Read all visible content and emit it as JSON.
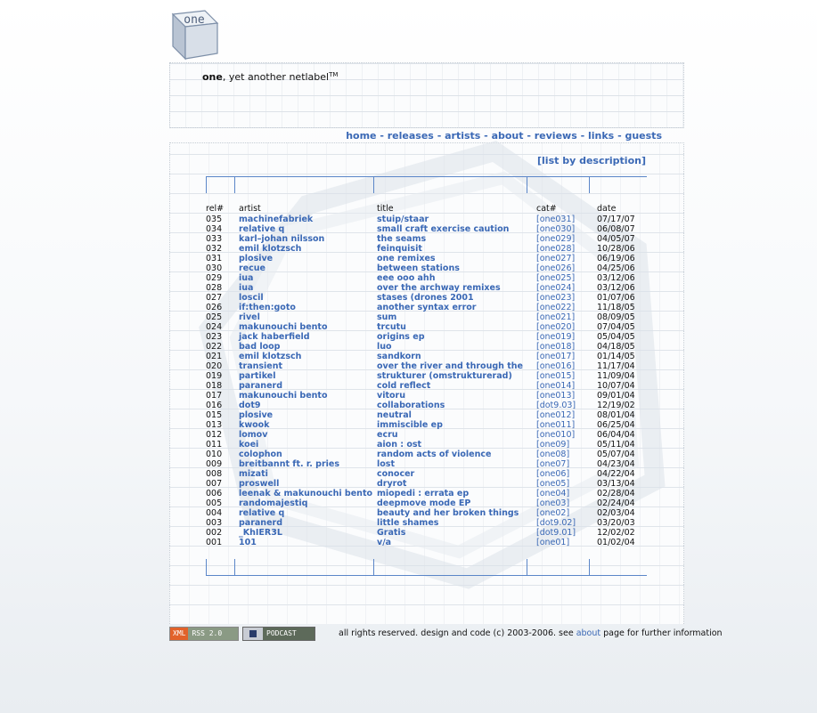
{
  "logo": {
    "text": "one"
  },
  "header": {
    "tagline_bold": "one",
    "tagline_rest": ", yet another netlabel",
    "tagline_tm": "TM"
  },
  "nav": {
    "items": [
      "home",
      "releases",
      "artists",
      "about",
      "reviews",
      "links",
      "guests"
    ],
    "separator": " - "
  },
  "list_by_link": "[list by description]",
  "table": {
    "headers": {
      "rel": "rel#",
      "artist": "artist",
      "title": "title",
      "cat": "cat#",
      "date": "date"
    },
    "rows": [
      {
        "rel": "035",
        "artist": "machinefabriek",
        "title": "stuip/staar",
        "cat": "[one031]",
        "date": "07/17/07"
      },
      {
        "rel": "034",
        "artist": "relative q",
        "title": "small craft exercise caution",
        "cat": "[one030]",
        "date": "06/08/07"
      },
      {
        "rel": "033",
        "artist": "karl–johan nilsson",
        "title": "the seams",
        "cat": "[one029]",
        "date": "04/05/07"
      },
      {
        "rel": "032",
        "artist": "emil klotzsch",
        "title": "feinquisit",
        "cat": "[one028]",
        "date": "10/28/06"
      },
      {
        "rel": "031",
        "artist": "plosive",
        "title": "one remixes",
        "cat": "[one027]",
        "date": "06/19/06"
      },
      {
        "rel": "030",
        "artist": "recue",
        "title": "between stations",
        "cat": "[one026]",
        "date": "04/25/06"
      },
      {
        "rel": "029",
        "artist": "iua",
        "title": "eee ooo ahh",
        "cat": "[one025]",
        "date": "03/12/06"
      },
      {
        "rel": "028",
        "artist": "iua",
        "title": "over the archway remixes",
        "cat": "[one024]",
        "date": "03/12/06"
      },
      {
        "rel": "027",
        "artist": "loscil",
        "title": "stases (drones 2001",
        "cat": "[one023]",
        "date": "01/07/06"
      },
      {
        "rel": "026",
        "artist": "if:then:goto",
        "title": "another syntax error",
        "cat": "[one022]",
        "date": "11/18/05"
      },
      {
        "rel": "025",
        "artist": "rivel",
        "title": "sum",
        "cat": "[one021]",
        "date": "08/09/05"
      },
      {
        "rel": "024",
        "artist": "makunouchi bento",
        "title": "trcutu",
        "cat": "[one020]",
        "date": "07/04/05"
      },
      {
        "rel": "023",
        "artist": "jack haberfield",
        "title": "origins ep",
        "cat": "[one019]",
        "date": "05/04/05"
      },
      {
        "rel": "022",
        "artist": "bad loop",
        "title": "luo",
        "cat": "[one018]",
        "date": "04/18/05"
      },
      {
        "rel": "021",
        "artist": "emil klotzsch",
        "title": "sandkorn",
        "cat": "[one017]",
        "date": "01/14/05"
      },
      {
        "rel": "020",
        "artist": "transient",
        "title": "over the river and through the",
        "cat": "[one016]",
        "date": "11/17/04"
      },
      {
        "rel": "019",
        "artist": "partikel",
        "title": "strukturer (omstrukturerad)",
        "cat": "[one015]",
        "date": "11/09/04"
      },
      {
        "rel": "018",
        "artist": "paranerd",
        "title": "cold reflect",
        "cat": "[one014]",
        "date": "10/07/04"
      },
      {
        "rel": "017",
        "artist": "makunouchi bento",
        "title": "vitoru",
        "cat": "[one013]",
        "date": "09/01/04"
      },
      {
        "rel": "016",
        "artist": "dot9",
        "title": "collaborations",
        "cat": "[dot9.03]",
        "date": "12/19/02"
      },
      {
        "rel": "015",
        "artist": "plosive",
        "title": "neutral",
        "cat": "[one012]",
        "date": "08/01/04"
      },
      {
        "rel": "013",
        "artist": "kwook",
        "title": "immiscible ep",
        "cat": "[one011]",
        "date": "06/25/04"
      },
      {
        "rel": "012",
        "artist": "lomov",
        "title": "ecru",
        "cat": "[one010]",
        "date": "06/04/04"
      },
      {
        "rel": "011",
        "artist": "koei",
        "title": "aion : ost",
        "cat": "[one09]",
        "date": "05/11/04"
      },
      {
        "rel": "010",
        "artist": "colophon",
        "title": "random acts of violence",
        "cat": "[one08]",
        "date": "05/07/04"
      },
      {
        "rel": "009",
        "artist": "breitbannt ft. r. pries",
        "title": "lost",
        "cat": "[one07]",
        "date": "04/23/04"
      },
      {
        "rel": "008",
        "artist": "mizati",
        "title": "conocer",
        "cat": "[one06]",
        "date": "04/22/04"
      },
      {
        "rel": "007",
        "artist": "proswell",
        "title": "dryrot",
        "cat": "[one05]",
        "date": "03/13/04"
      },
      {
        "rel": "006",
        "artist": "leenak & makunouchi bento",
        "title": "miopedi : errata ep",
        "cat": "[one04]",
        "date": "02/28/04"
      },
      {
        "rel": "005",
        "artist": "randomajestiq",
        "title": "deepmove mode EP",
        "cat": "[one03]",
        "date": "02/24/04"
      },
      {
        "rel": "004",
        "artist": "relative q",
        "title": "beauty and her broken things",
        "cat": "[one02]",
        "date": "02/03/04"
      },
      {
        "rel": "003",
        "artist": "paranerd",
        "title": "little shames",
        "cat": "[dot9.02]",
        "date": "03/20/03"
      },
      {
        "rel": "002",
        "artist": "_KhIER3L",
        "title": "Gratis",
        "cat": "[dot9.01]",
        "date": "12/02/02"
      },
      {
        "rel": "001",
        "artist": "101",
        "title": "v/a",
        "cat": "[one01]",
        "date": "01/02/04"
      }
    ]
  },
  "footer": {
    "rss_left": "XML",
    "rss_right": "RSS 2.0",
    "podcast": "PODCAST",
    "copyright_pre": "all rights reserved. design and code (c) 2003-2006. see ",
    "about_link": "about",
    "copyright_post": " page for further information"
  },
  "colors": {
    "link": "#3a68b5",
    "rule": "#5b86c8"
  }
}
